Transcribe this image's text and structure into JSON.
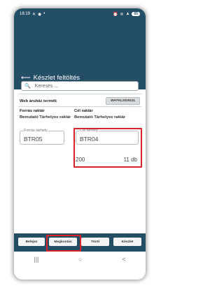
{
  "status_bar": {
    "time": "18:19",
    "left_icons": [
      "x-icon",
      "chat-icon",
      "dot-icon"
    ],
    "right_icons": [
      "alarm-icon",
      "wifi-icon",
      "signal-icon"
    ],
    "battery": "65"
  },
  "header": {
    "title": "Készlet feltöltés"
  },
  "search": {
    "placeholder": "Keresés ..."
  },
  "store": {
    "label": "Web áruház termék",
    "chip": "WATKL2025111"
  },
  "source": {
    "title": "Forrás raktár",
    "warehouse": "Bemutató Tárhelyes raktár",
    "location_legend": "Forrás tárhely",
    "location_value": "BTR05"
  },
  "target": {
    "title": "Cél raktár",
    "warehouse": "Bemutató Tárhelyes raktár",
    "location_legend": "Cél tárhely",
    "location_value": "BTR04",
    "code": "200",
    "quantity": "11 db"
  },
  "buttons": {
    "save": "Befejez",
    "cancel": "Megbontás",
    "delete": "Töröl",
    "done": "Készlet"
  },
  "nav": {
    "recents": "|||",
    "home": "○",
    "back": "<"
  },
  "colors": {
    "primary": "#244e66",
    "highlight": "#d8232a"
  }
}
